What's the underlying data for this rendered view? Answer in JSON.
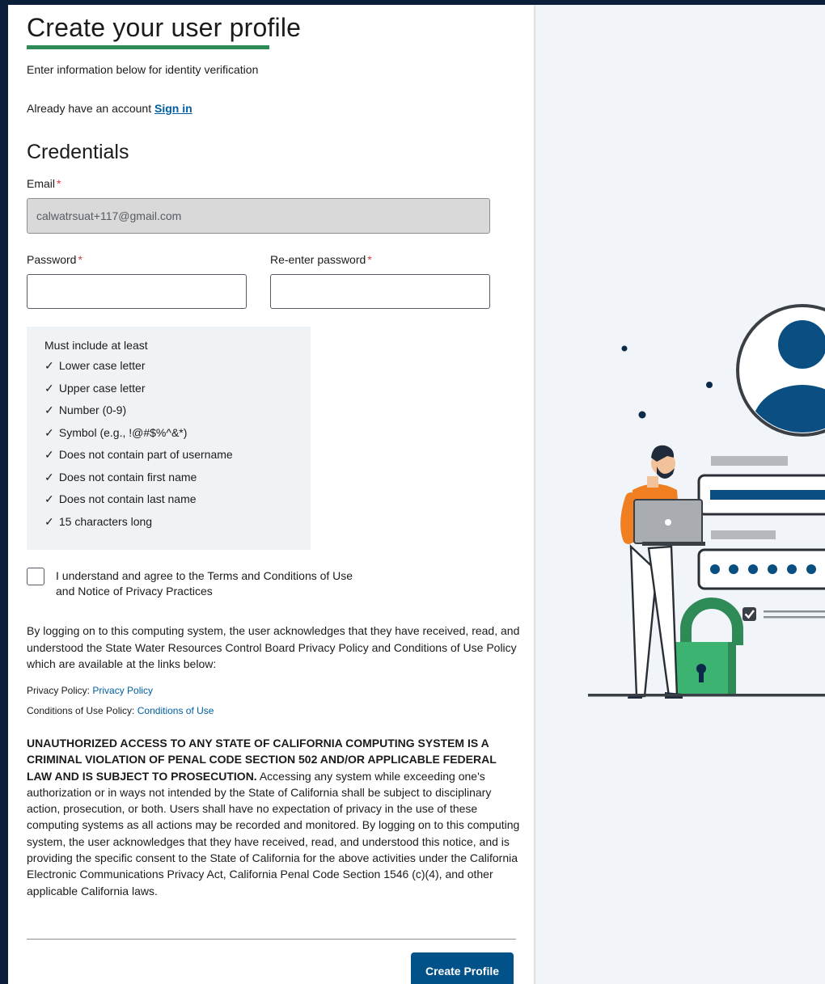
{
  "header": {
    "title": "Create your user profile",
    "subtitle": "Enter information below for identity verification",
    "have_account_text": "Already have an account",
    "sign_in_link": "Sign in"
  },
  "credentials": {
    "section_title": "Credentials",
    "email_label": "Email",
    "email_value": "calwatrsuat+117@gmail.com",
    "password_label": "Password",
    "password_value": "",
    "reenter_label": "Re-enter password",
    "reenter_value": "",
    "required_marker": "*"
  },
  "password_rules": {
    "heading": "Must include at least",
    "check_glyph": "✓",
    "items": [
      "Lower case letter",
      "Upper case letter",
      "Number (0-9)",
      "Symbol (e.g., !@#$%^&*)",
      "Does not contain part of username",
      "Does not contain first name",
      "Does not contain last name",
      "15 characters long"
    ]
  },
  "agreement": {
    "checked": false,
    "line1": "I understand and agree to the Terms and Conditions of Use",
    "line2": "and Notice of Privacy Practices"
  },
  "notice": {
    "paragraph": "By logging on to this computing system, the user acknowledges that they have received, read, and understood the State Water Resources Control Board Privacy Policy and Conditions of Use Policy which are available at the links below:",
    "privacy_label": "Privacy Policy:",
    "privacy_link": "Privacy Policy",
    "conditions_label": "Conditions of Use Policy:",
    "conditions_link": "Conditions of Use"
  },
  "warning": {
    "bold": "UNAUTHORIZED ACCESS TO ANY STATE OF CALIFORNIA COMPUTING SYSTEM IS A CRIMINAL VIOLATION OF PENAL CODE SECTION 502 AND/OR APPLICABLE FEDERAL LAW AND IS SUBJECT TO PROSECUTION.",
    "body": "Accessing any system while exceeding one's authorization or in ways not intended by the State of California shall be subject to disciplinary action, prosecution, or both. Users shall have no expectation of privacy in the use of these computing systems as all actions may be recorded and monitored. By logging on to this computing system, the user acknowledges that they have received, read, and understood this notice, and is providing the specific consent to the State of California for the above activities under the California Electronic Communications Privacy Act, California Penal Code Section 1546 (c)(4), and other applicable California laws."
  },
  "actions": {
    "create_profile": "Create Profile"
  },
  "colors": {
    "accent_green": "#2e8b57",
    "primary_blue": "#005288",
    "link_blue": "#005ea2",
    "required_red": "#d83933",
    "background_navy": "#0b1e3a",
    "illustration_orange": "#f07f22",
    "illustration_dark_blue": "#0b4f82"
  },
  "illustration": {
    "icons": [
      "user-avatar-icon",
      "padlock-icon",
      "laptop-icon",
      "checkbox-icon"
    ]
  }
}
